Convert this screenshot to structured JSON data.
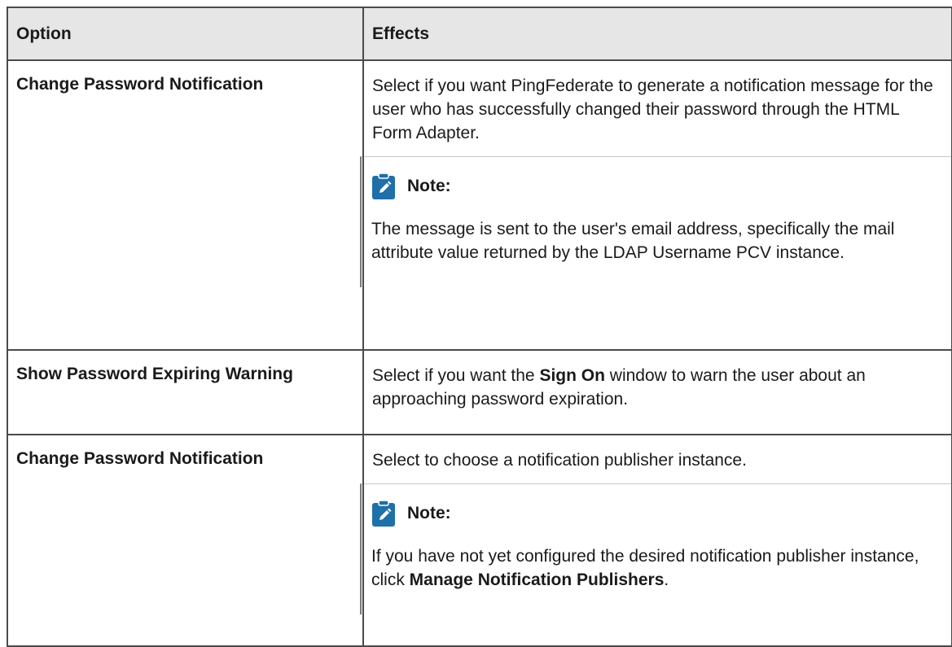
{
  "table": {
    "headers": {
      "option": "Option",
      "effects": "Effects"
    },
    "rows": [
      {
        "option": "Change Password Notification",
        "effect": "Select if you want PingFederate to generate a notification message for the user who has successfully changed their password through the HTML Form Adapter.",
        "note": {
          "label": "Note:",
          "text": "The message is sent to the user's email address, specifically the mail attribute value returned by the LDAP Username PCV instance."
        }
      },
      {
        "option": "Show Password Expiring Warning",
        "effect_pre": "Select if you want the ",
        "effect_bold": "Sign On",
        "effect_post": " window to warn the user about an approaching password expiration."
      },
      {
        "option": "Change Password Notification",
        "effect": "Select to choose a notification publisher instance.",
        "note": {
          "label": "Note:",
          "text_pre": "If you have not yet configured the desired notification publisher instance, click ",
          "text_bold": "Manage Notification Publishers",
          "text_post": "."
        }
      }
    ]
  },
  "colors": {
    "note_icon": "#1f6fa8",
    "header_bg": "#e6e6e6",
    "border": "#4a4a4a"
  },
  "icons": {
    "note": "edit-note-icon"
  }
}
